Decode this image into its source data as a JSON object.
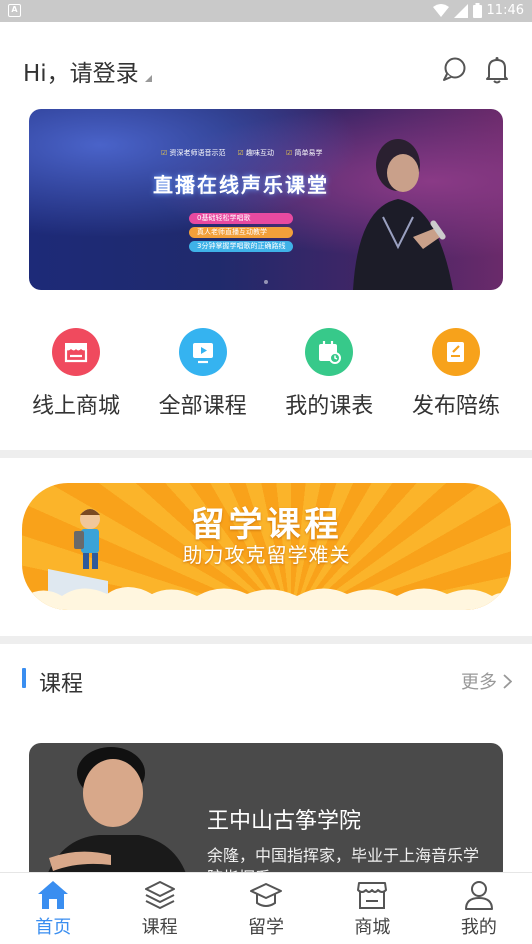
{
  "status_bar": {
    "time": "11:46",
    "battery": "8"
  },
  "header": {
    "greeting": "Hi，请登录"
  },
  "banner": {
    "tags": [
      "资深老师语音示范",
      "趣味互动",
      "简单易学"
    ],
    "title": "直播在线声乐课堂",
    "pills": [
      {
        "text": "0基础轻松学唱歌",
        "color": "#e84aa0"
      },
      {
        "text": "真人老师直播互动教学",
        "color": "#f2a03a"
      },
      {
        "text": "3分钟掌握学唱歌的正确路线",
        "color": "#3fb2e8"
      }
    ]
  },
  "quick_nav": [
    {
      "label": "线上商城",
      "icon": "store-icon",
      "color": "#f04a5e"
    },
    {
      "label": "全部课程",
      "icon": "video-play-icon",
      "color": "#35b3f0"
    },
    {
      "label": "我的课表",
      "icon": "calendar-icon",
      "color": "#37c98a"
    },
    {
      "label": "发布陪练",
      "icon": "note-edit-icon",
      "color": "#f7a21b"
    }
  ],
  "study_abroad": {
    "title": "留学课程",
    "subtitle": "助力攻克留学难关"
  },
  "courses_section": {
    "title": "课程",
    "more": "更多"
  },
  "course_card": {
    "name": "王中山古筝学院",
    "description": "余隆，中国指挥家，毕业于上海音乐学院指挥系"
  },
  "tabbar": [
    {
      "label": "首页",
      "icon": "home-icon",
      "active": true
    },
    {
      "label": "课程",
      "icon": "layers-icon",
      "active": false
    },
    {
      "label": "留学",
      "icon": "graduation-cap-icon",
      "active": false
    },
    {
      "label": "商城",
      "icon": "shop-icon",
      "active": false
    },
    {
      "label": "我的",
      "icon": "user-icon",
      "active": false
    }
  ],
  "colors": {
    "accent": "#3a8ef0"
  }
}
